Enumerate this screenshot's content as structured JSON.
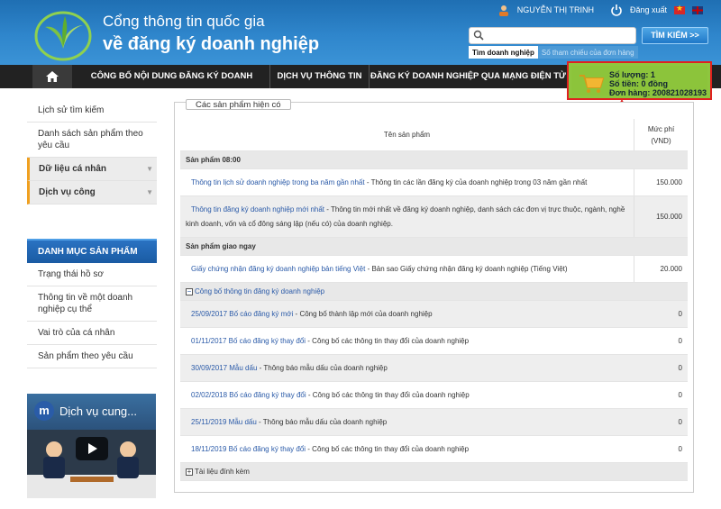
{
  "header": {
    "title_line1": "Cổng thông tin quốc gia",
    "title_line2": "về đăng ký doanh nghiệp",
    "user_name": "NGUYỄN THỊ TRINH",
    "logout": "Đăng xuất",
    "search_button": "TÌM KIẾM >>",
    "search_placeholder": "",
    "search_tabs": [
      "Tìm doanh nghiệp",
      "Số tham chiếu của đơn hàng"
    ]
  },
  "nav": {
    "items": [
      "CÔNG BỐ NỘI DUNG ĐĂNG KÝ DOANH NGHIỆP",
      "DỊCH VỤ THÔNG TIN",
      "ĐĂNG KÝ DOANH NGHIỆP QUA MẠNG ĐIỆN TỬ"
    ]
  },
  "cart": {
    "quantity": "Số lượng: 1",
    "amount": "Số tiền: 0 đồng",
    "order": "Đơn hàng: 200821028193"
  },
  "sidebar": {
    "items_top": [
      "Lịch sử tìm kiếm",
      "Danh sách sản phẩm theo yêu cầu"
    ],
    "items_dark": [
      "Dữ liệu cá nhân",
      "Dịch vụ công"
    ],
    "catalog_header": "DANH MỤC SẢN PHẨM",
    "catalog_items": [
      "Trạng thái hồ sơ",
      "Thông tin về một doanh nghiệp cụ thể",
      "Vai trò của cá nhân",
      "Sản phẩm theo yêu cầu"
    ],
    "video_title": "Dịch vụ cung..."
  },
  "main": {
    "legend": "Các sản phẩm hiện có",
    "col_name": "Tên sản phẩm",
    "col_fee_line1": "Mức phí",
    "col_fee_line2": "(VND)",
    "group1": "Sản phẩm 08:00",
    "g1_rows": [
      {
        "link": "Thông tin lịch sử doanh nghiệp trong ba năm gần nhất",
        "desc": " - Thông tin các lần đăng ký của doanh nghiệp trong 03 năm gần nhất",
        "fee": "150.000"
      },
      {
        "link": "Thông tin đăng ký doanh nghiệp mới nhất",
        "desc": " - Thông tin mới nhất về đăng ký doanh nghiệp, danh sách các đơn vị trực thuộc, ngành, nghề kinh doanh, vốn và cổ đông sáng lập (nếu có) của doanh nghiệp.",
        "fee": "150.000"
      }
    ],
    "group2": "Sản phẩm giao ngay",
    "g2_rows": [
      {
        "link": "Giấy chứng nhận đăng ký doanh nghiệp bản tiếng Việt",
        "desc": " - Bản sao Giấy chứng nhận đăng ký doanh nghiệp (Tiếng Việt)",
        "fee": "20.000"
      }
    ],
    "group3": "Công bố thông tin đăng ký doanh nghiệp",
    "g3_rows": [
      {
        "link": "25/09/2017 Bố cáo đăng ký mới",
        "desc": " - Công bố thành lập mới của doanh nghiệp",
        "fee": "0"
      },
      {
        "link": "01/11/2017 Bố cáo đăng ký thay đổi",
        "desc": " - Công bố các thông tin thay đổi của doanh nghiệp",
        "fee": "0"
      },
      {
        "link": "30/09/2017 Mẫu dấu",
        "desc": " - Thông báo mẫu dấu của doanh nghiệp",
        "fee": "0"
      },
      {
        "link": "02/02/2018 Bố cáo đăng ký thay đổi",
        "desc": " - Công bố các thông tin thay đổi của doanh nghiệp",
        "fee": "0"
      },
      {
        "link": "25/11/2019 Mẫu dấu",
        "desc": " - Thông báo mẫu dấu của doanh nghiệp",
        "fee": "0"
      },
      {
        "link": "18/11/2019 Bố cáo đăng ký thay đổi",
        "desc": " - Công bố các thông tin thay đổi của doanh nghiệp",
        "fee": "0"
      }
    ],
    "group4": "Tài liệu đính kèm"
  }
}
